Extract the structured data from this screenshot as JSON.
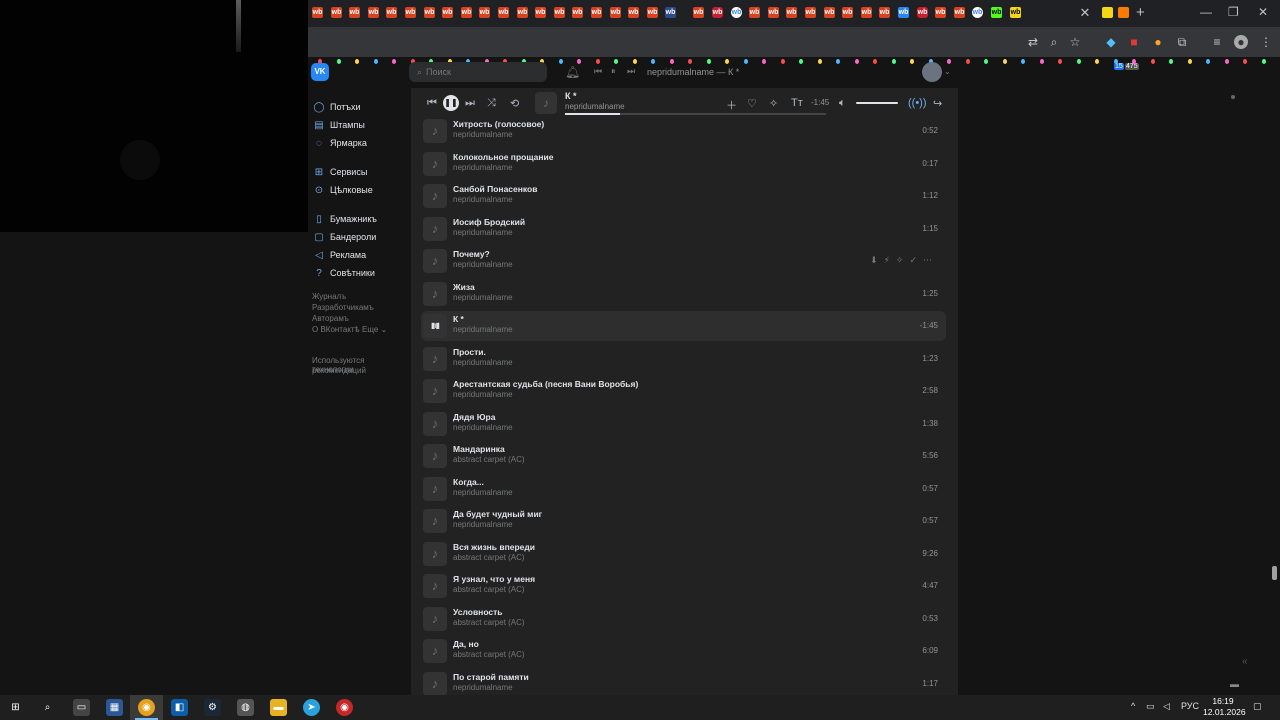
{
  "browser": {
    "tab_icons": [
      "wb",
      "wb",
      "wb",
      "wb",
      "wb",
      "wb",
      "wb",
      "wb",
      "wb",
      "wb",
      "wb",
      "wb",
      "wb",
      "wb",
      "wb",
      "wb",
      "wb",
      "wb",
      "wb",
      "wb",
      "wb",
      "wb",
      "wb",
      "wb",
      "wb",
      "wb",
      "wb",
      "wb",
      "wb",
      "wb",
      "wb",
      "wb",
      "wb",
      "wb",
      "wb",
      "wb",
      "wb",
      "wb",
      "wb",
      "wb",
      "wb",
      "wb"
    ],
    "active_tab_close": "✕",
    "new_tab": "+",
    "window_controls": [
      "—",
      "❐",
      "✕"
    ],
    "extension_badges": [
      "15",
      "475"
    ]
  },
  "vk": {
    "logo": "VK",
    "search_placeholder": "Поиск",
    "header_now_playing": "nepridumalname — К *",
    "sidebar": {
      "items": [
        {
          "label": "Потъхи",
          "icon": "user-icon"
        },
        {
          "label": "Штампы",
          "icon": "newspaper-icon"
        },
        {
          "label": "Ярмарка",
          "icon": "chat-icon"
        },
        {
          "label": "Сервисы",
          "icon": "grid-icon"
        },
        {
          "label": "Цѣлковые",
          "icon": "coin-icon"
        },
        {
          "label": "Бумажникъ",
          "icon": "bookmark-icon"
        },
        {
          "label": "Бандероли",
          "icon": "box-icon"
        },
        {
          "label": "Реклама",
          "icon": "megaphone-icon"
        },
        {
          "label": "Совѣтники",
          "icon": "help-icon"
        }
      ],
      "footer_links": [
        "Журналъ",
        "Разработчикамъ",
        "Авторамъ",
        "О ВКонтактѣ",
        "Еще ⌄"
      ],
      "footer_note_line1": "Используются технологии",
      "footer_note_line2": "рекомендаций"
    },
    "player": {
      "title": "К *",
      "artist": "nepridumalname",
      "time": "-1:45",
      "progress": 0.21,
      "volume": 0.8
    },
    "tracks": [
      {
        "title": "Хитрость (голосовое)",
        "artist": "nepridumalname",
        "duration": "0:52"
      },
      {
        "title": "Колокольное прощание",
        "artist": "nepridumalname",
        "duration": "0:17"
      },
      {
        "title": "Санбой Понасенков",
        "artist": "nepridumalname",
        "duration": "1:12"
      },
      {
        "title": "Иосиф Бродский",
        "artist": "nepridumalname",
        "duration": "1:15"
      },
      {
        "title": "Почему?",
        "artist": "nepridumalname",
        "duration": "",
        "hover": true
      },
      {
        "title": "Жиза",
        "artist": "nepridumalname",
        "duration": "1:25"
      },
      {
        "title": "К *",
        "artist": "nepridumalname",
        "duration": "-1:45",
        "active": true
      },
      {
        "title": "Прости.",
        "artist": "nepridumalname",
        "duration": "1:23"
      },
      {
        "title": "Арестантская судьба (песня Вани Воробья)",
        "artist": "nepridumalname",
        "duration": "2:58"
      },
      {
        "title": "Дядя Юра",
        "artist": "nepridumalname",
        "duration": "1:38"
      },
      {
        "title": "Мандаринка",
        "artist": "abstract carpet (AC)",
        "duration": "5:56"
      },
      {
        "title": "Когда...",
        "artist": "nepridumalname",
        "duration": "0:57"
      },
      {
        "title": "Да будет чудный миг",
        "artist": "nepridumalname",
        "duration": "0:57"
      },
      {
        "title": "Вся жизнь впереди",
        "artist": "abstract carpet (AC)",
        "duration": "9:26"
      },
      {
        "title": "Я узнал, что у меня",
        "artist": "abstract carpet (AC)",
        "duration": "4:47"
      },
      {
        "title": "Условность",
        "artist": "abstract carpet (AC)",
        "duration": "0:53"
      },
      {
        "title": "Да, но",
        "artist": "abstract carpet (AC)",
        "duration": "6:09"
      },
      {
        "title": "По старой памяти",
        "artist": "nepridumalname",
        "duration": "1:17"
      }
    ]
  },
  "taskbar": {
    "lang": "РУС",
    "time": "16:19",
    "date": "12.01.2026"
  }
}
